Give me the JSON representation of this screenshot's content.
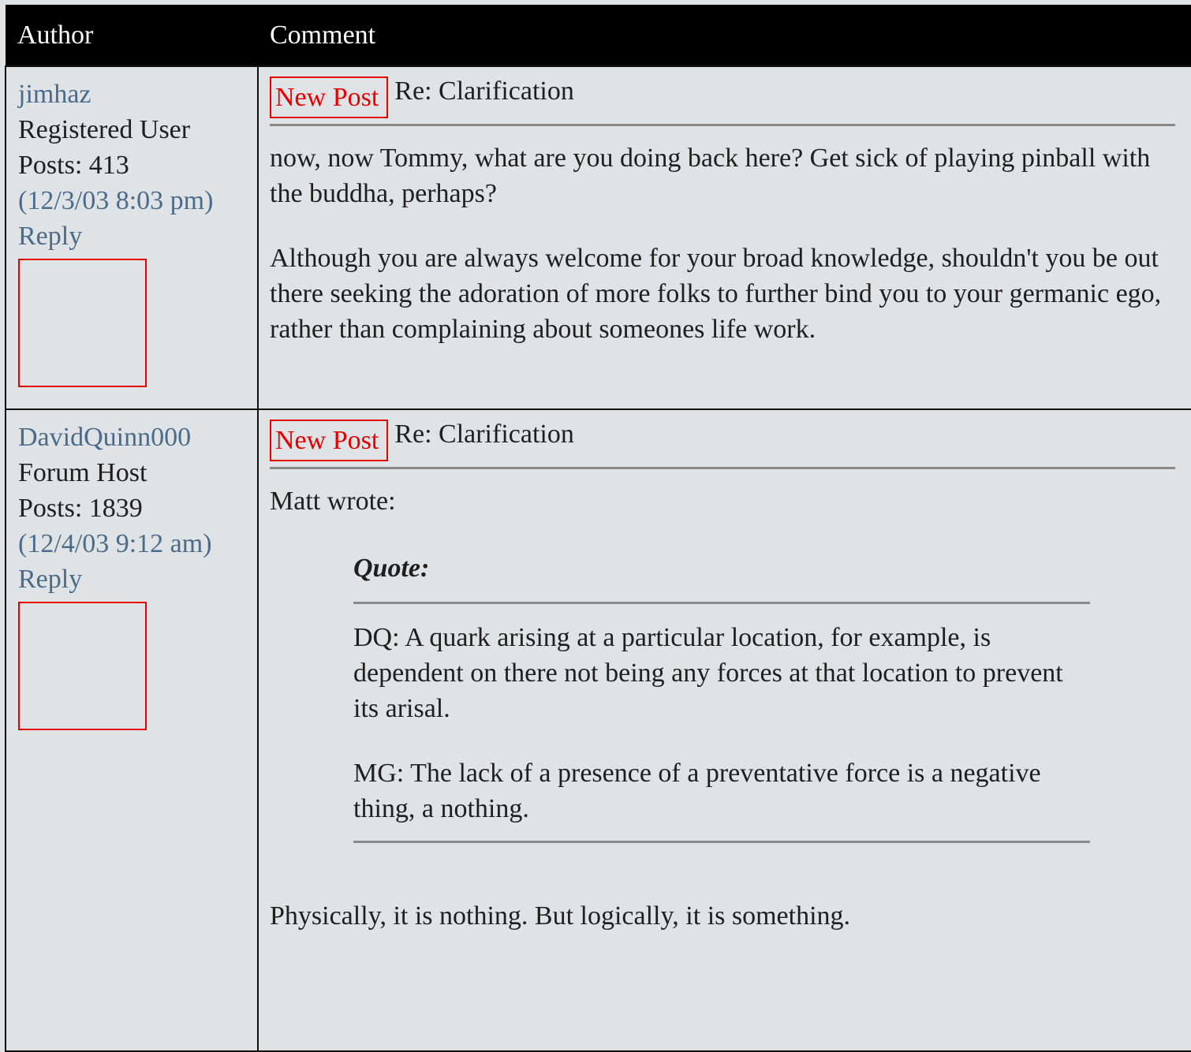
{
  "table": {
    "headers": {
      "author": "Author",
      "comment": "Comment"
    }
  },
  "posts": [
    {
      "author": "jimhaz",
      "role": "Registered User",
      "posts": "Posts: 413",
      "date": "(12/3/03 8:03 pm)",
      "reply": "Reply",
      "new_post": "New Post",
      "subject": "Re: Clarification",
      "paragraphs": [
        "now, now Tommy, what are you doing back here? Get sick of playing pinball with the buddha, perhaps?",
        "Although you are always welcome for your broad knowledge, shouldn't you be out there seeking the adoration of more folks to further bind you to your germanic ego, rather than complaining about someones life work."
      ]
    },
    {
      "author": "DavidQuinn000",
      "role": "Forum Host",
      "posts": "Posts: 1839",
      "date": "(12/4/03 9:12 am)",
      "reply": "Reply",
      "new_post": "New Post",
      "subject": "Re: Clarification",
      "intro": "Matt wrote:",
      "quote_title": "Quote:",
      "quote_paragraphs": [
        "DQ: A quark arising at a particular location, for example, is dependent on there not being any forces at that location to prevent its arisal.",
        "MG: The lack of a presence of a preventative force is a negative thing, a nothing."
      ],
      "outro": "Physically, it is nothing. But logically, it is something."
    }
  ],
  "colors": {
    "background": "#dfe3e6",
    "header_bg": "#000000",
    "link": "#4a6b8a",
    "new_post": "#e60000",
    "rule": "#8a8a8a"
  }
}
